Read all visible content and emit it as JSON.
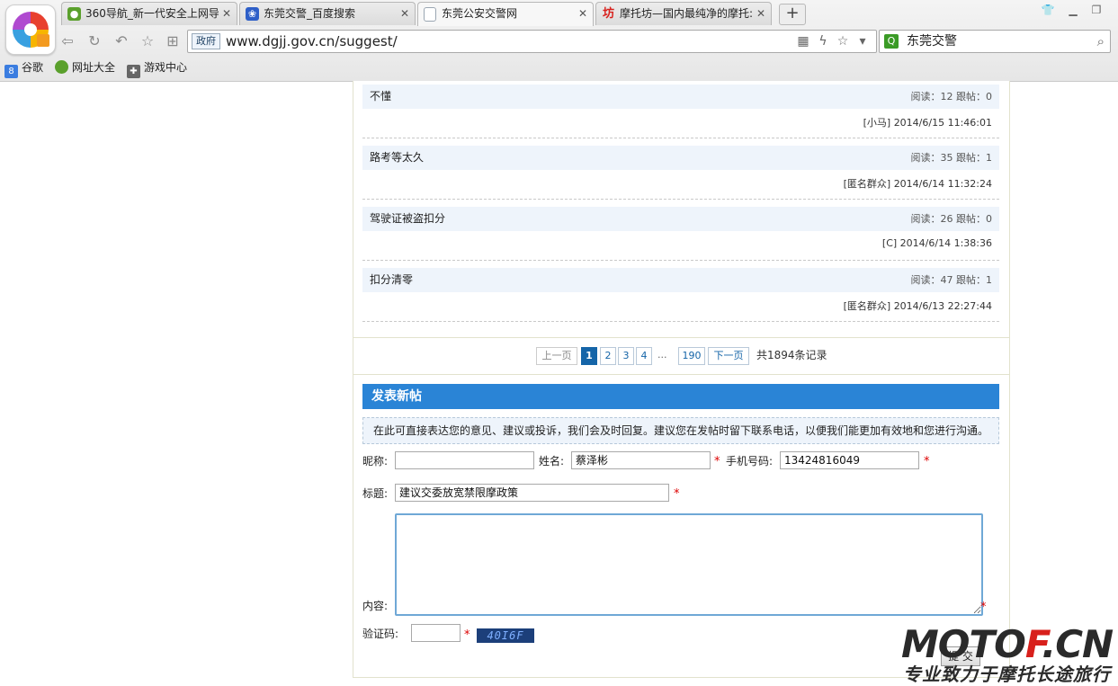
{
  "browser": {
    "tabs": [
      {
        "label": "360导航_新一代安全上网导",
        "icon_color": "#5aa02c"
      },
      {
        "label": "东莞交警_百度搜索",
        "icon_color": "#2e5fc8"
      },
      {
        "label": "东莞公安交警网",
        "icon_color": "#9aa6b2"
      },
      {
        "label": "摩托坊—国内最纯净的摩托:",
        "icon_color": "#d8201c"
      }
    ],
    "tab_icons": [
      "360-icon",
      "baidu-paw-icon",
      "page-icon",
      "fang-icon"
    ],
    "tab_glyph_4": "坊",
    "new_tab": "+",
    "gov_badge": "政府",
    "url": "www.dgjj.gov.cn/suggest/",
    "search_value": "东莞交警",
    "bookmarks": [
      {
        "label": "谷歌",
        "icon": "google-icon",
        "color": "#3b7de0",
        "glyph": "8"
      },
      {
        "label": "网址大全",
        "icon": "360-icon",
        "color": "#5aa02c",
        "glyph": ""
      },
      {
        "label": "游戏中心",
        "icon": "gamepad-icon",
        "color": "#666666",
        "glyph": ""
      }
    ]
  },
  "posts": [
    {
      "title": "不懂",
      "stats": "阅读：12 跟帖：0",
      "meta": "[小马] 2014/6/15 11:46:01"
    },
    {
      "title": "路考等太久",
      "stats": "阅读：35 跟帖：1",
      "meta": "[匿名群众] 2014/6/14 11:32:24"
    },
    {
      "title": "驾驶证被盗扣分",
      "stats": "阅读：26 跟帖：0",
      "meta": "[C] 2014/6/14 1:38:36"
    },
    {
      "title": "扣分清零",
      "stats": "阅读：47 跟帖：1",
      "meta": "[匿名群众] 2014/6/13 22:27:44"
    }
  ],
  "pager": {
    "prev": "上一页",
    "pages": [
      "1",
      "2",
      "3",
      "4"
    ],
    "current": "1",
    "dots": "...",
    "last": "190",
    "next": "下一页",
    "total": "共1894条记录"
  },
  "form": {
    "title": "发表新帖",
    "notice": "在此可直接表达您的意见、建议或投诉，我们会及时回复。建议您在发帖时留下联系电话，以便我们能更加有效地和您进行沟通。",
    "nickname_label": "昵称:",
    "nickname_value": "",
    "name_label": "姓名:",
    "name_value": "蔡泽彬",
    "phone_label": "手机号码:",
    "phone_value": "13424816049",
    "subject_label": "标题:",
    "subject_value": "建议交委放宽禁限摩政策",
    "content_label": "内容:",
    "content_value": "",
    "captcha_label": "验证码:",
    "captcha_value": "",
    "captcha_image_text": "40I6F",
    "required_mark": "*",
    "submit": "提 交"
  },
  "watermark": {
    "brand_main": "MOTO",
    "brand_accent": "F",
    "brand_tail": ".CN",
    "slogan": "专业致力于摩托长途旅行"
  },
  "colors": {
    "accent": "#2a84d6",
    "link": "#1565a8",
    "required": "#d00000"
  }
}
